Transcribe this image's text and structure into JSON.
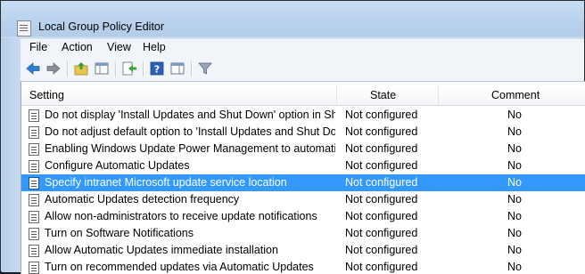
{
  "window": {
    "title": "Local Group Policy Editor"
  },
  "menu": [
    "File",
    "Action",
    "View",
    "Help"
  ],
  "toolbar": {
    "icons": [
      "back-arrow-icon",
      "forward-arrow-icon",
      "up-folder-icon",
      "show-hide-tree-icon",
      "export-list-icon",
      "help-icon",
      "properties-pane-icon",
      "filter-icon"
    ]
  },
  "list": {
    "columns": {
      "setting": "Setting",
      "state": "State",
      "comment": "Comment"
    },
    "rows": [
      {
        "setting": "Do not display 'Install Updates and Shut Down' option in Sh...",
        "state": "Not configured",
        "comment": "No"
      },
      {
        "setting": "Do not adjust default option to 'Install Updates and Shut Do...",
        "state": "Not configured",
        "comment": "No"
      },
      {
        "setting": "Enabling Windows Update Power Management to automati...",
        "state": "Not configured",
        "comment": "No"
      },
      {
        "setting": "Configure Automatic Updates",
        "state": "Not configured",
        "comment": "No"
      },
      {
        "setting": "Specify intranet Microsoft update service location",
        "state": "Not configured",
        "comment": "No",
        "selected": true
      },
      {
        "setting": "Automatic Updates detection frequency",
        "state": "Not configured",
        "comment": "No"
      },
      {
        "setting": "Allow non-administrators to receive update notifications",
        "state": "Not configured",
        "comment": "No"
      },
      {
        "setting": "Turn on Software Notifications",
        "state": "Not configured",
        "comment": "No"
      },
      {
        "setting": "Allow Automatic Updates immediate installation",
        "state": "Not configured",
        "comment": "No"
      },
      {
        "setting": "Turn on recommended updates via Automatic Updates",
        "state": "Not configured",
        "comment": "No"
      }
    ]
  },
  "colors": {
    "selection": "#3399ff",
    "chrome": "#c4d9ef"
  }
}
